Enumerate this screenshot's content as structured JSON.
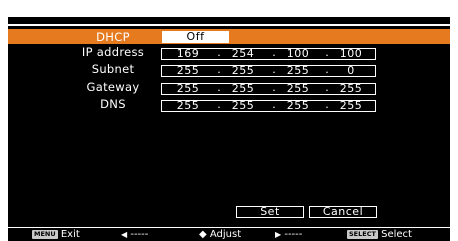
{
  "menu": {
    "dhcp": {
      "label": "DHCP",
      "value": "Off"
    },
    "ip_address": {
      "label": "IP address",
      "octets": [
        "169",
        "254",
        "100",
        "100"
      ]
    },
    "subnet": {
      "label": "Subnet",
      "octets": [
        "255",
        "255",
        "255",
        "0"
      ]
    },
    "gateway": {
      "label": "Gateway",
      "octets": [
        "255",
        "255",
        "255",
        "255"
      ]
    },
    "dns": {
      "label": "DNS",
      "octets": [
        "255",
        "255",
        "255",
        "255"
      ]
    },
    "separator": "."
  },
  "buttons": {
    "set_label": "Set",
    "cancel_label": "Cancel"
  },
  "footer": {
    "menu_key": "MENU",
    "exit_label": "Exit",
    "left_arrow": "◀",
    "left_action": "-----",
    "updown_arrow": "◆",
    "adjust_label": "Adjust",
    "right_arrow": "▶",
    "right_action": "-----",
    "select_key": "SELECT",
    "select_label": "Select"
  },
  "colors": {
    "highlight": "#e57a1e",
    "background": "#000000",
    "text": "#ffffff"
  }
}
